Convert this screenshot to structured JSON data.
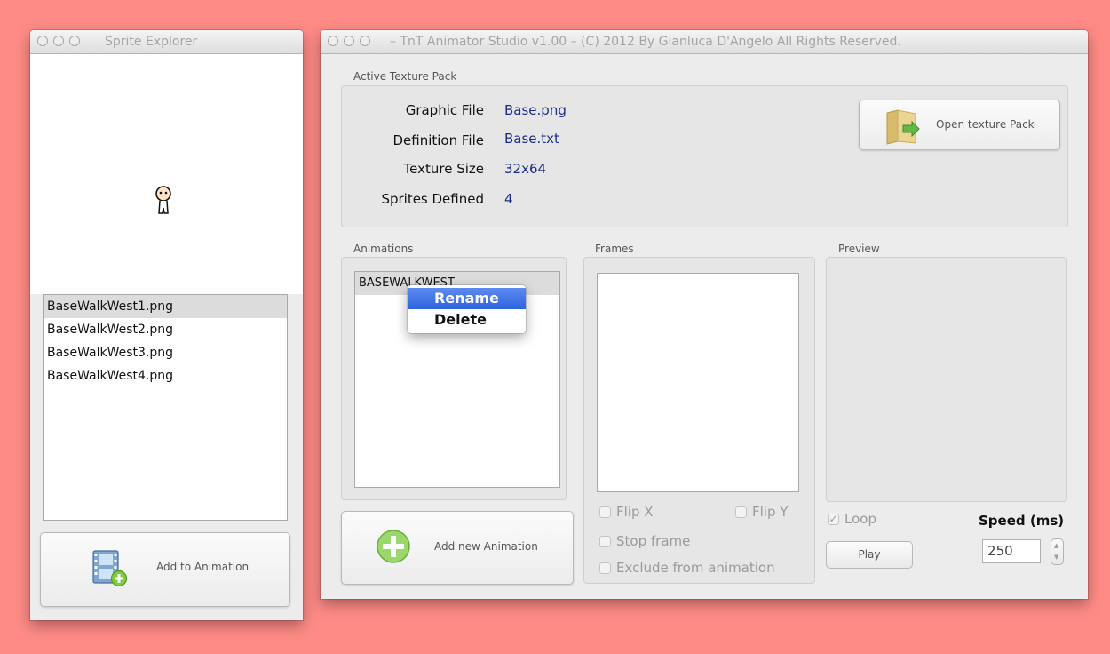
{
  "sprite_explorer": {
    "title": "Sprite Explorer",
    "sprites": [
      "BaseWalkWest1.png",
      "BaseWalkWest2.png",
      "BaseWalkWest3.png",
      "BaseWalkWest4.png"
    ],
    "selected_index": 0,
    "add_button_label": "Add to Animation"
  },
  "main": {
    "title": "– TnT Animator Studio v1.00 – (C) 2012 By Gianluca D'Angelo All Rights Reserved.",
    "texture_pack": {
      "group_label": "Active Texture Pack",
      "graphic_file_label": "Graphic File",
      "graphic_file_value": "Base.png",
      "definition_file_label": "Definition File",
      "definition_file_value": "Base.txt",
      "texture_size_label": "Texture Size",
      "texture_size_value": "32x64",
      "sprites_defined_label": "Sprites Defined",
      "sprites_defined_value": "4",
      "open_button_label": "Open texture Pack"
    },
    "animations": {
      "group_label": "Animations",
      "items": [
        "BASEWALKWEST"
      ],
      "add_button_label": "Add new Animation"
    },
    "context_menu": {
      "items": [
        "Rename",
        "Delete"
      ],
      "highlighted_index": 0
    },
    "frames": {
      "group_label": "Frames",
      "flip_x_label": "Flip X",
      "flip_y_label": "Flip Y",
      "stop_frame_label": "Stop frame",
      "exclude_label": "Exclude from animation"
    },
    "preview": {
      "group_label": "Preview",
      "loop_label": "Loop",
      "loop_checked": true,
      "speed_label": "Speed (ms)",
      "speed_value": "250",
      "play_button_label": "Play"
    }
  },
  "colors": {
    "background": "#fe8b86",
    "value_text": "#1a2d8c",
    "menu_highlight": "#3a6ee6"
  }
}
